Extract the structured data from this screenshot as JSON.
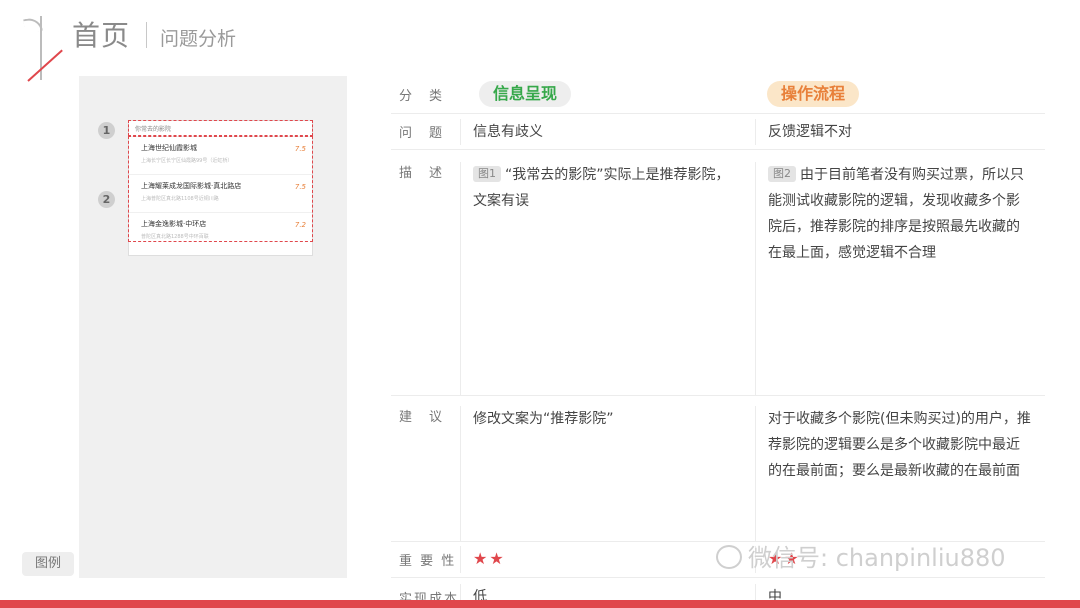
{
  "header": {
    "number": "1",
    "title": "首页",
    "subtitle": "问题分析"
  },
  "mock": {
    "section_header": "你常去的影院",
    "cinemas": [
      {
        "name": "上海世纪仙霞影城",
        "address": "上海长宁区长宁区仙霞路99号（近虹桥）",
        "score": "7.5"
      },
      {
        "name": "上海耀莱成龙国际影城·真北路店",
        "address": "上海普陀区真北路1108号近铜川路",
        "score": "7.5"
      },
      {
        "name": "上海金逸影城·中环店",
        "address": "普陀区真北路1288号中环百联",
        "score": "7.2"
      }
    ],
    "badge1": "1",
    "badge2": "2",
    "legend": "图例"
  },
  "table": {
    "labels": {
      "category": "分　类",
      "problem": "问　题",
      "description": "描　述",
      "suggestion": "建　议",
      "importance": "重 要 性",
      "cost": "实现成本"
    },
    "col_a": {
      "category": "信息呈现",
      "problem": "信息有歧义",
      "desc_tag": "图1",
      "description": "“我常去的影院”实际上是推荐影院，文案有误",
      "suggestion": "修改文案为“推荐影院”",
      "importance": "★★",
      "cost": "低"
    },
    "col_b": {
      "category": "操作流程",
      "problem": "反馈逻辑不对",
      "desc_tag": "图2",
      "description": "由于目前笔者没有购买过票，所以只能测试收藏影院的逻辑，发现收藏多个影院后，推荐影院的排序是按照最先收藏的在最上面，感觉逻辑不合理",
      "suggestion": "对于收藏多个影院(但未购买过)的用户，推荐影院的逻辑要么是多个收藏影院中最近的在最前面；要么是最新收藏的在最前面",
      "importance": "★★",
      "cost": "中"
    }
  },
  "watermark": "微信号: chanpinliu880",
  "colors": {
    "accent_red": "#e0474c",
    "green": "#36a84a",
    "orange": "#e8803a"
  }
}
